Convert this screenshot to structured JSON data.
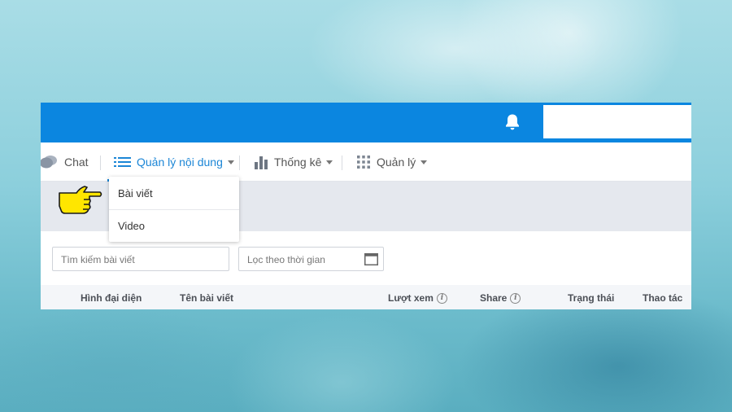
{
  "nav": {
    "chat_label": "Chat",
    "content_label": "Quản lý nội dung",
    "stats_label": "Thống kê",
    "manage_label": "Quản lý"
  },
  "dropdown": {
    "items": [
      {
        "label": "Bài viết"
      },
      {
        "label": "Video"
      }
    ]
  },
  "filters": {
    "search_placeholder": "Tìm kiếm bài viết",
    "time_placeholder": "Lọc theo thời gian"
  },
  "table": {
    "headers": {
      "avatar": "Hình đại diện",
      "title": "Tên bài viết",
      "views": "Lượt xem",
      "share": "Share",
      "status": "Trạng thái",
      "actions": "Thao tác"
    }
  },
  "colors": {
    "topbar": "#0b86e0",
    "accent": "#1c86d6",
    "pointer": "#ffe600"
  }
}
